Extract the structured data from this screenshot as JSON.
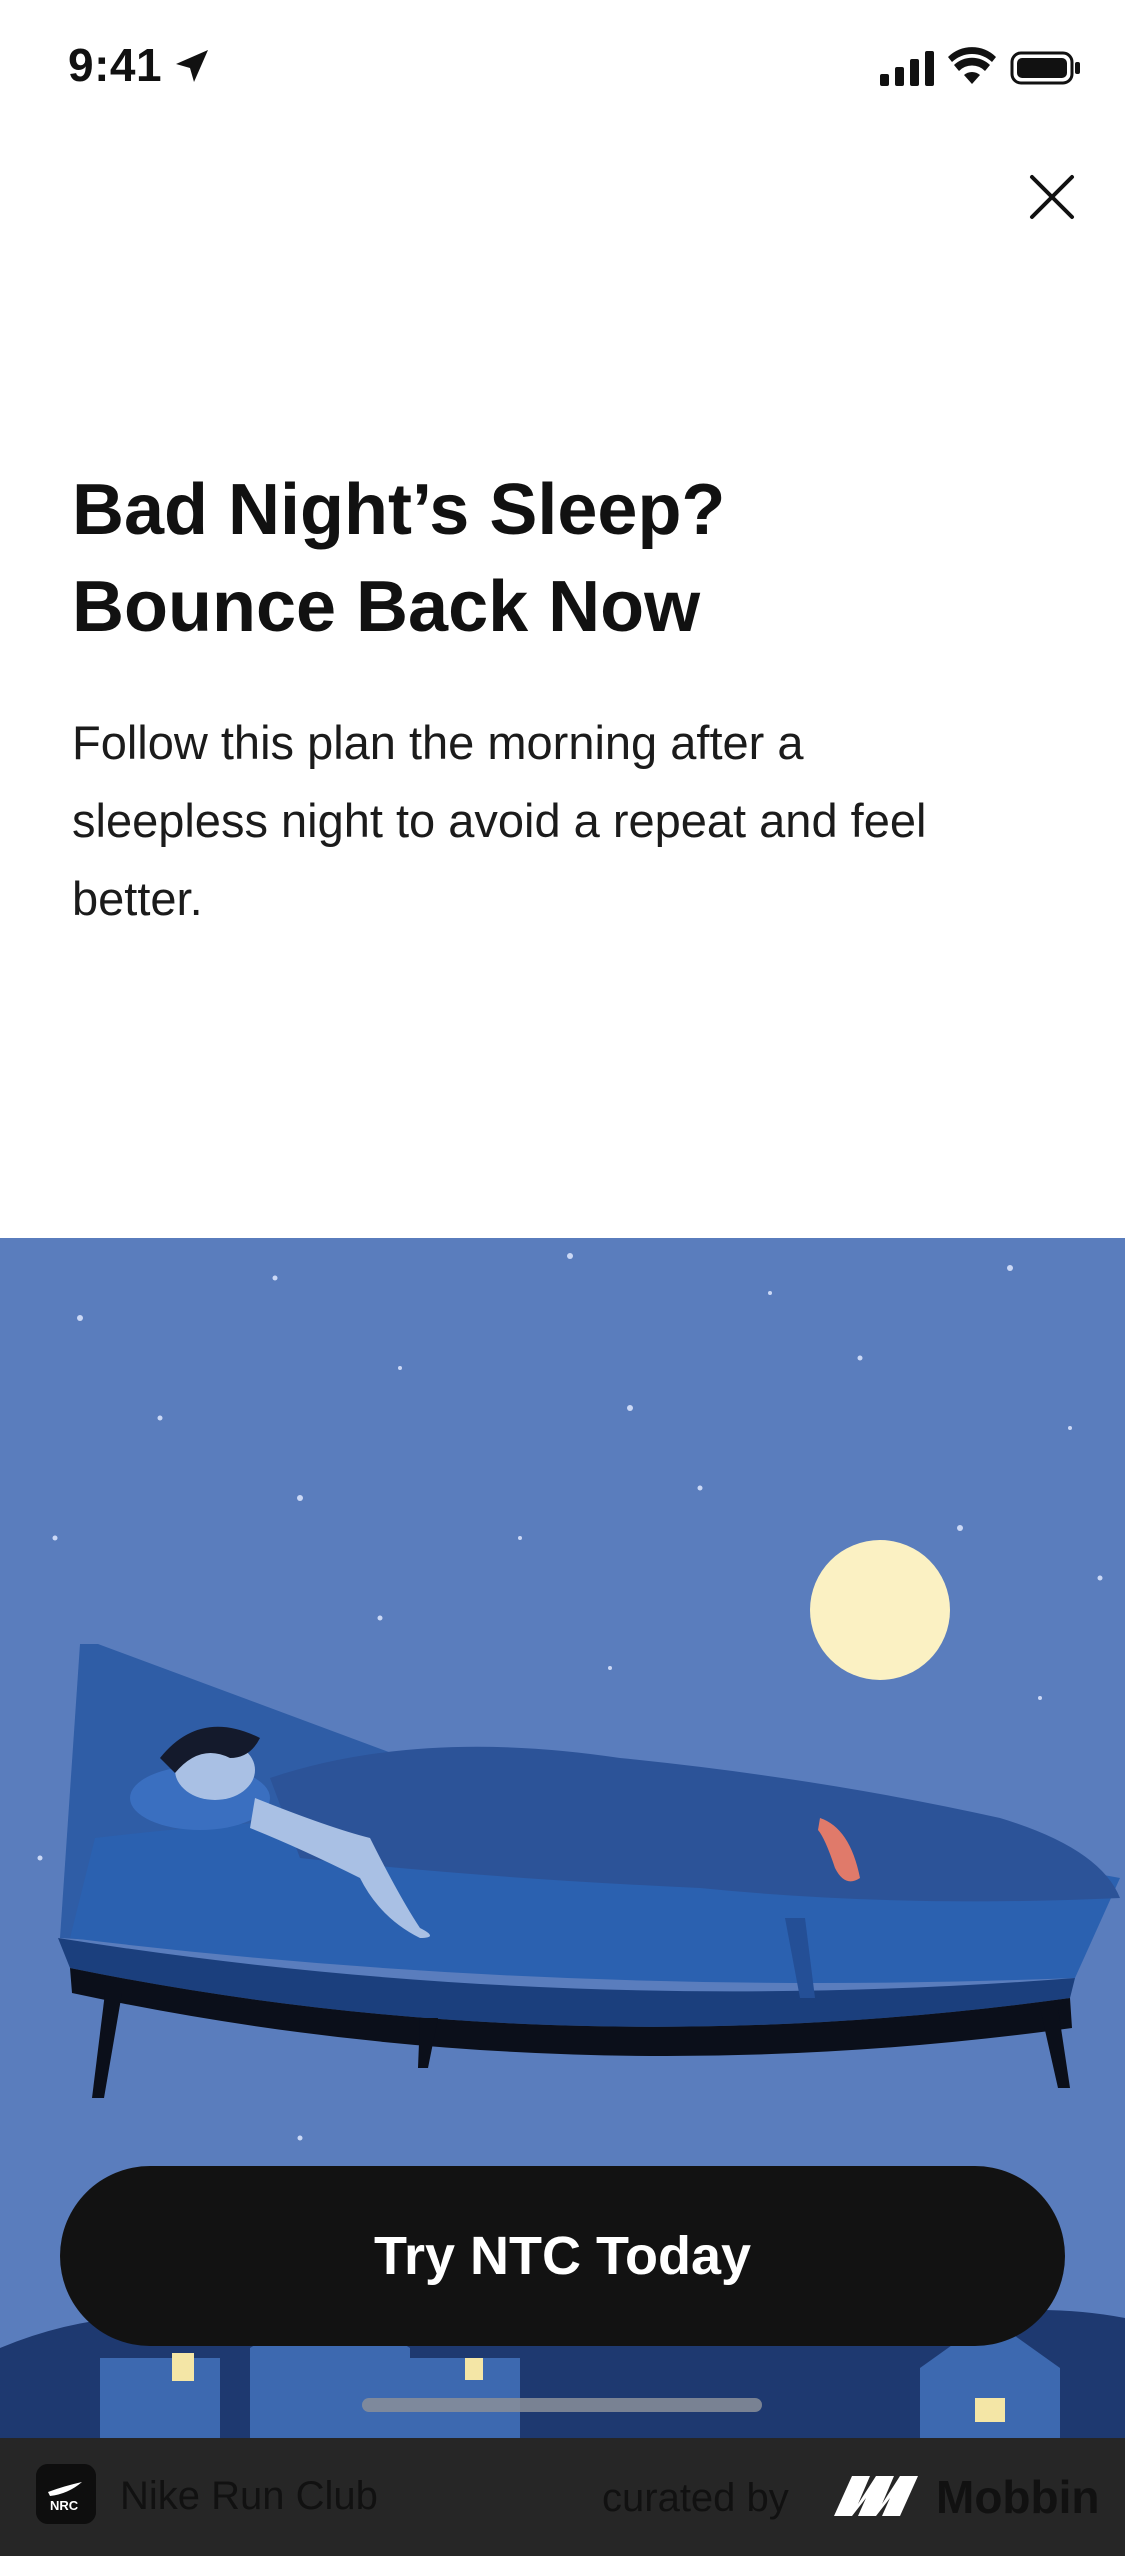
{
  "status_bar": {
    "time": "9:41"
  },
  "header": {
    "close_label": "Close"
  },
  "content": {
    "title_line1": "Bad Night’s Sleep?",
    "title_line2": "Bounce Back Now",
    "description": "Follow this plan the morning after a sleepless night to avoid a repeat and feel better."
  },
  "illustration": {
    "icon": "sleeping-person-illustration"
  },
  "cta": {
    "label": "Try NTC Today"
  },
  "footer": {
    "app_name": "Nike Run Club",
    "curated_label": "curated by",
    "brand": "Mobbin",
    "app_icon_text": "NRC"
  },
  "colors": {
    "sky": "#5a7dbd",
    "button": "#121212",
    "footer": "#262626",
    "moon": "#fbf1c3"
  }
}
